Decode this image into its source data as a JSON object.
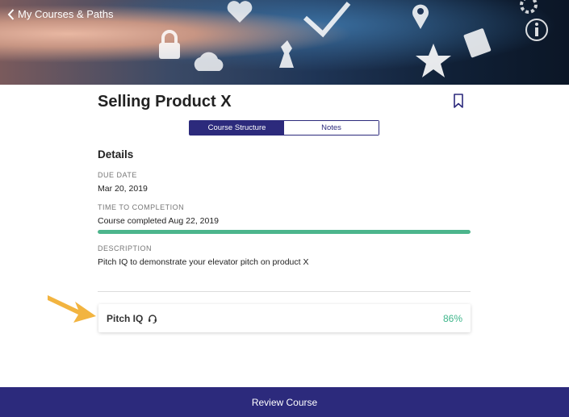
{
  "nav": {
    "back_label": "My Courses & Paths"
  },
  "course": {
    "title": "Selling Product X"
  },
  "tabs": [
    {
      "label": "Course Structure",
      "active": true
    },
    {
      "label": "Notes",
      "active": false
    }
  ],
  "details": {
    "heading": "Details",
    "due_date_label": "DUE DATE",
    "due_date": "Mar 20, 2019",
    "time_label": "TIME TO COMPLETION",
    "time_value": "Course completed Aug 22, 2019",
    "progress_fraction": 1.0,
    "description_label": "DESCRIPTION",
    "description": "Pitch IQ to demonstrate your elevator pitch on product X"
  },
  "items": [
    {
      "name": "Pitch IQ",
      "icon": "headset-icon",
      "score": "86%"
    }
  ],
  "footer": {
    "label": "Review Course"
  },
  "colors": {
    "primary": "#2c2a7c",
    "success": "#4cb58c",
    "arrow": "#f2b440"
  }
}
